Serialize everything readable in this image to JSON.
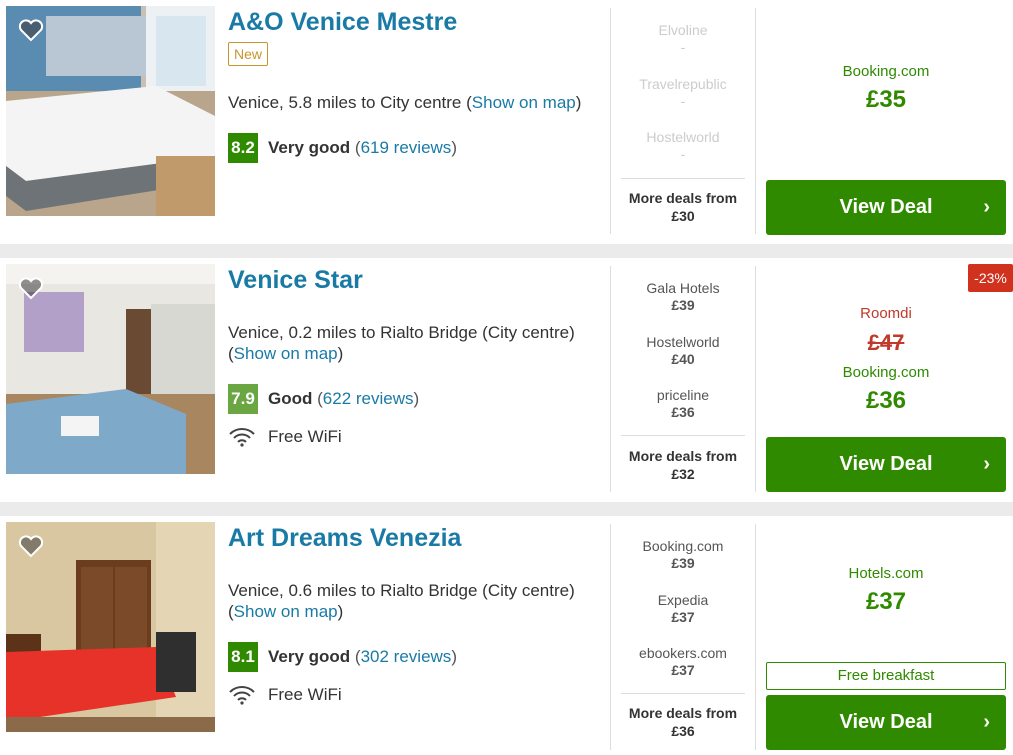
{
  "hotels": [
    {
      "name": "A&O Venice Mestre",
      "badge": "New",
      "location": "Venice, 5.8 miles to City centre",
      "map_link": "Show on map",
      "score": "8.2",
      "rating_label": "Very good",
      "reviews": "619 reviews",
      "amenity": "",
      "deals": [
        {
          "provider": "Elvoline",
          "price": "-"
        },
        {
          "provider": "Travelrepublic",
          "price": "-"
        },
        {
          "provider": "Hostelworld",
          "price": "-"
        }
      ],
      "more_label": "More deals from",
      "more_price": "£30",
      "main_provider": "Booking.com",
      "main_price": "£35",
      "cta": "View Deal"
    },
    {
      "name": "Venice Star",
      "location": "Venice, 0.2 miles to Rialto Bridge (City centre)",
      "map_link": "Show on map",
      "score": "7.9",
      "rating_label": "Good",
      "reviews": "622 reviews",
      "amenity": "Free WiFi",
      "deals": [
        {
          "provider": "Gala Hotels",
          "price": "£39"
        },
        {
          "provider": "Hostelworld",
          "price": "£40"
        },
        {
          "provider": "priceline",
          "price": "£36"
        }
      ],
      "more_label": "More deals from",
      "more_price": "£32",
      "discount": "-23%",
      "old_provider": "Roomdi",
      "old_price": "£47",
      "main_provider": "Booking.com",
      "main_price": "£36",
      "cta": "View Deal"
    },
    {
      "name": "Art Dreams Venezia",
      "location": "Venice, 0.6 miles to Rialto Bridge (City centre)",
      "map_link": "Show on map",
      "score": "8.1",
      "rating_label": "Very good",
      "reviews": "302 reviews",
      "amenity": "Free WiFi",
      "deals": [
        {
          "provider": "Booking.com",
          "price": "£39"
        },
        {
          "provider": "Expedia",
          "price": "£37"
        },
        {
          "provider": "ebookers.com",
          "price": "£37"
        }
      ],
      "more_label": "More deals from",
      "more_price": "£36",
      "main_provider": "Hotels.com",
      "main_price": "£37",
      "perk": "Free breakfast",
      "cta": "View Deal"
    }
  ],
  "icons": {
    "favorite": "heart-icon",
    "wifi": "wifi-icon",
    "chevron": "chevron-right-icon"
  },
  "colors": {
    "brand_blue": "#1a7aa6",
    "deal_green": "#2f8a00",
    "discount_red": "#d0321e"
  }
}
